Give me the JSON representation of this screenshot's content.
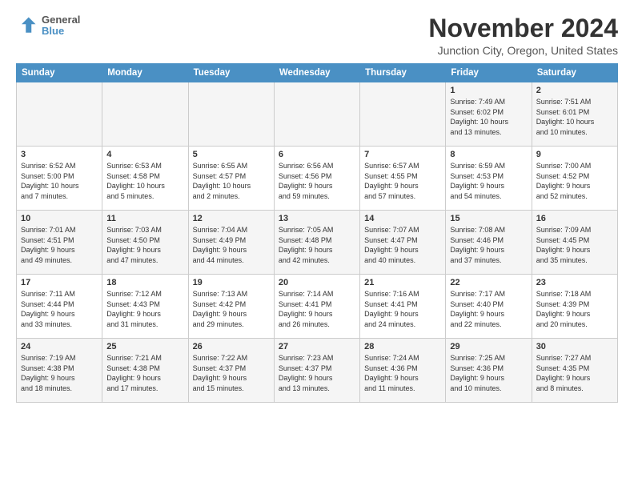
{
  "logo": {
    "line1": "General",
    "line2": "Blue"
  },
  "title": "November 2024",
  "location": "Junction City, Oregon, United States",
  "headers": [
    "Sunday",
    "Monday",
    "Tuesday",
    "Wednesday",
    "Thursday",
    "Friday",
    "Saturday"
  ],
  "weeks": [
    [
      {
        "day": "",
        "info": ""
      },
      {
        "day": "",
        "info": ""
      },
      {
        "day": "",
        "info": ""
      },
      {
        "day": "",
        "info": ""
      },
      {
        "day": "",
        "info": ""
      },
      {
        "day": "1",
        "info": "Sunrise: 7:49 AM\nSunset: 6:02 PM\nDaylight: 10 hours\nand 13 minutes."
      },
      {
        "day": "2",
        "info": "Sunrise: 7:51 AM\nSunset: 6:01 PM\nDaylight: 10 hours\nand 10 minutes."
      }
    ],
    [
      {
        "day": "3",
        "info": "Sunrise: 6:52 AM\nSunset: 5:00 PM\nDaylight: 10 hours\nand 7 minutes."
      },
      {
        "day": "4",
        "info": "Sunrise: 6:53 AM\nSunset: 4:58 PM\nDaylight: 10 hours\nand 5 minutes."
      },
      {
        "day": "5",
        "info": "Sunrise: 6:55 AM\nSunset: 4:57 PM\nDaylight: 10 hours\nand 2 minutes."
      },
      {
        "day": "6",
        "info": "Sunrise: 6:56 AM\nSunset: 4:56 PM\nDaylight: 9 hours\nand 59 minutes."
      },
      {
        "day": "7",
        "info": "Sunrise: 6:57 AM\nSunset: 4:55 PM\nDaylight: 9 hours\nand 57 minutes."
      },
      {
        "day": "8",
        "info": "Sunrise: 6:59 AM\nSunset: 4:53 PM\nDaylight: 9 hours\nand 54 minutes."
      },
      {
        "day": "9",
        "info": "Sunrise: 7:00 AM\nSunset: 4:52 PM\nDaylight: 9 hours\nand 52 minutes."
      }
    ],
    [
      {
        "day": "10",
        "info": "Sunrise: 7:01 AM\nSunset: 4:51 PM\nDaylight: 9 hours\nand 49 minutes."
      },
      {
        "day": "11",
        "info": "Sunrise: 7:03 AM\nSunset: 4:50 PM\nDaylight: 9 hours\nand 47 minutes."
      },
      {
        "day": "12",
        "info": "Sunrise: 7:04 AM\nSunset: 4:49 PM\nDaylight: 9 hours\nand 44 minutes."
      },
      {
        "day": "13",
        "info": "Sunrise: 7:05 AM\nSunset: 4:48 PM\nDaylight: 9 hours\nand 42 minutes."
      },
      {
        "day": "14",
        "info": "Sunrise: 7:07 AM\nSunset: 4:47 PM\nDaylight: 9 hours\nand 40 minutes."
      },
      {
        "day": "15",
        "info": "Sunrise: 7:08 AM\nSunset: 4:46 PM\nDaylight: 9 hours\nand 37 minutes."
      },
      {
        "day": "16",
        "info": "Sunrise: 7:09 AM\nSunset: 4:45 PM\nDaylight: 9 hours\nand 35 minutes."
      }
    ],
    [
      {
        "day": "17",
        "info": "Sunrise: 7:11 AM\nSunset: 4:44 PM\nDaylight: 9 hours\nand 33 minutes."
      },
      {
        "day": "18",
        "info": "Sunrise: 7:12 AM\nSunset: 4:43 PM\nDaylight: 9 hours\nand 31 minutes."
      },
      {
        "day": "19",
        "info": "Sunrise: 7:13 AM\nSunset: 4:42 PM\nDaylight: 9 hours\nand 29 minutes."
      },
      {
        "day": "20",
        "info": "Sunrise: 7:14 AM\nSunset: 4:41 PM\nDaylight: 9 hours\nand 26 minutes."
      },
      {
        "day": "21",
        "info": "Sunrise: 7:16 AM\nSunset: 4:41 PM\nDaylight: 9 hours\nand 24 minutes."
      },
      {
        "day": "22",
        "info": "Sunrise: 7:17 AM\nSunset: 4:40 PM\nDaylight: 9 hours\nand 22 minutes."
      },
      {
        "day": "23",
        "info": "Sunrise: 7:18 AM\nSunset: 4:39 PM\nDaylight: 9 hours\nand 20 minutes."
      }
    ],
    [
      {
        "day": "24",
        "info": "Sunrise: 7:19 AM\nSunset: 4:38 PM\nDaylight: 9 hours\nand 18 minutes."
      },
      {
        "day": "25",
        "info": "Sunrise: 7:21 AM\nSunset: 4:38 PM\nDaylight: 9 hours\nand 17 minutes."
      },
      {
        "day": "26",
        "info": "Sunrise: 7:22 AM\nSunset: 4:37 PM\nDaylight: 9 hours\nand 15 minutes."
      },
      {
        "day": "27",
        "info": "Sunrise: 7:23 AM\nSunset: 4:37 PM\nDaylight: 9 hours\nand 13 minutes."
      },
      {
        "day": "28",
        "info": "Sunrise: 7:24 AM\nSunset: 4:36 PM\nDaylight: 9 hours\nand 11 minutes."
      },
      {
        "day": "29",
        "info": "Sunrise: 7:25 AM\nSunset: 4:36 PM\nDaylight: 9 hours\nand 10 minutes."
      },
      {
        "day": "30",
        "info": "Sunrise: 7:27 AM\nSunset: 4:35 PM\nDaylight: 9 hours\nand 8 minutes."
      }
    ]
  ]
}
